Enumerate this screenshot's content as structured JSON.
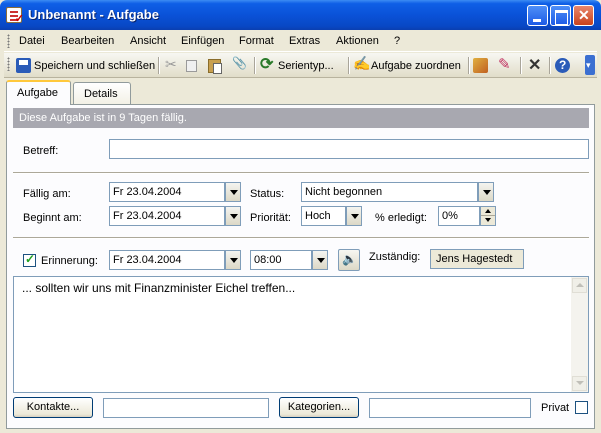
{
  "window": {
    "title": "Unbenannt - Aufgabe"
  },
  "menu": [
    "Datei",
    "Bearbeiten",
    "Ansicht",
    "Einfügen",
    "Format",
    "Extras",
    "Aktionen",
    "?"
  ],
  "toolbar": {
    "save_close": "Speichern und schließen",
    "recurrence": "Serientyp...",
    "assign": "Aufgabe zuordnen"
  },
  "tabs": [
    "Aufgabe",
    "Details"
  ],
  "banner": "Diese Aufgabe ist in 9 Tagen fällig.",
  "form": {
    "subject_label": "Betreff:",
    "subject_value": "",
    "due_label": "Fällig am:",
    "due_value": "Fr 23.04.2004",
    "start_label": "Beginnt am:",
    "start_value": "Fr 23.04.2004",
    "status_label": "Status:",
    "status_value": "Nicht begonnen",
    "priority_label": "Priorität:",
    "priority_value": "Hoch",
    "percent_label": "% erledigt:",
    "percent_value": "0%",
    "reminder_checked": true,
    "reminder_label": "Erinnerung:",
    "reminder_date": "Fr 23.04.2004",
    "reminder_time": "08:00",
    "owner_label": "Zuständig:",
    "owner_value": "Jens Hagestedt",
    "notes": "... sollten wir uns mit Finanzminister Eichel treffen...",
    "contacts_button": "Kontakte...",
    "contacts_value": "",
    "categories_button": "Kategorien...",
    "categories_value": "",
    "private_label": "Privat",
    "private_checked": false
  },
  "colors": {
    "title_bar": "#0a52d8",
    "banner": "#a8a8b0",
    "face": "#ece9d8"
  }
}
